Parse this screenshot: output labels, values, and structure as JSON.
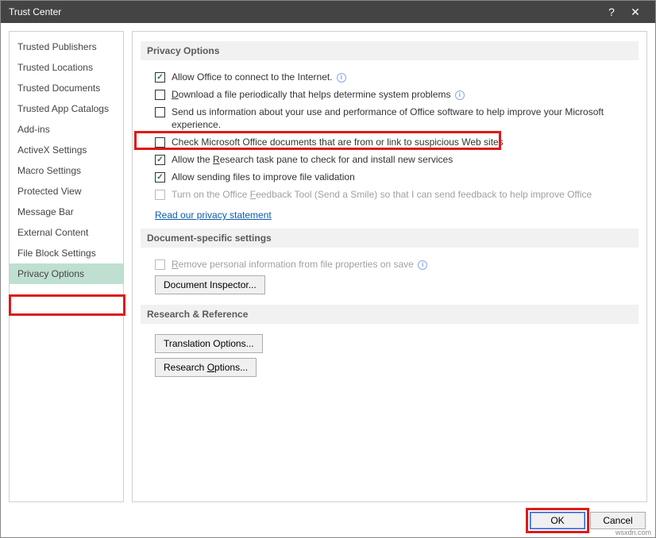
{
  "window": {
    "title": "Trust Center"
  },
  "sidebar": {
    "items": [
      {
        "label": "Trusted Publishers"
      },
      {
        "label": "Trusted Locations"
      },
      {
        "label": "Trusted Documents"
      },
      {
        "label": "Trusted App Catalogs"
      },
      {
        "label": "Add-ins"
      },
      {
        "label": "ActiveX Settings"
      },
      {
        "label": "Macro Settings"
      },
      {
        "label": "Protected View"
      },
      {
        "label": "Message Bar"
      },
      {
        "label": "External Content"
      },
      {
        "label": "File Block Settings"
      },
      {
        "label": "Privacy Options"
      }
    ],
    "active_index": 11
  },
  "sections": {
    "privacy": {
      "header": "Privacy Options",
      "opt_connect": {
        "checked": true,
        "label": "Allow Office to connect to the Internet.",
        "info": true
      },
      "opt_download": {
        "checked": false,
        "label_pre": "",
        "ak": "D",
        "label_post": "ownload a file periodically that helps determine system problems",
        "info": true
      },
      "opt_send": {
        "checked": false,
        "label": "Send us information about your use and performance of Office software to help improve your Microsoft experience."
      },
      "opt_check": {
        "checked": false,
        "label": "Check Microsoft Office documents that are from or link to suspicious Web sites"
      },
      "opt_research": {
        "checked": true,
        "label_pre": "Allow the ",
        "ak": "R",
        "label_post": "esearch task pane to check for and install new services"
      },
      "opt_sending": {
        "checked": true,
        "label": "Allow sending files to improve file validation"
      },
      "opt_feedback": {
        "checked": false,
        "disabled": true,
        "label_pre": "Turn on the Office ",
        "ak": "F",
        "label_post": "eedback Tool (Send a Smile) so that I can send feedback to help improve Office"
      },
      "link": "Read our privacy statement"
    },
    "docspec": {
      "header": "Document-specific settings",
      "opt_remove": {
        "checked": false,
        "disabled": true,
        "label_pre": "",
        "ak": "R",
        "label_post": "emove personal information from file properties on save",
        "info": true
      },
      "btn_inspect": "Document Inspector..."
    },
    "research": {
      "header": "Research & Reference",
      "btn_translate": "Translation Options...",
      "btn_research_pre": "Research ",
      "btn_research_ak": "O",
      "btn_research_post": "ptions..."
    }
  },
  "footer": {
    "ok": "OK",
    "cancel": "Cancel"
  },
  "watermark": "wsxdn.com"
}
